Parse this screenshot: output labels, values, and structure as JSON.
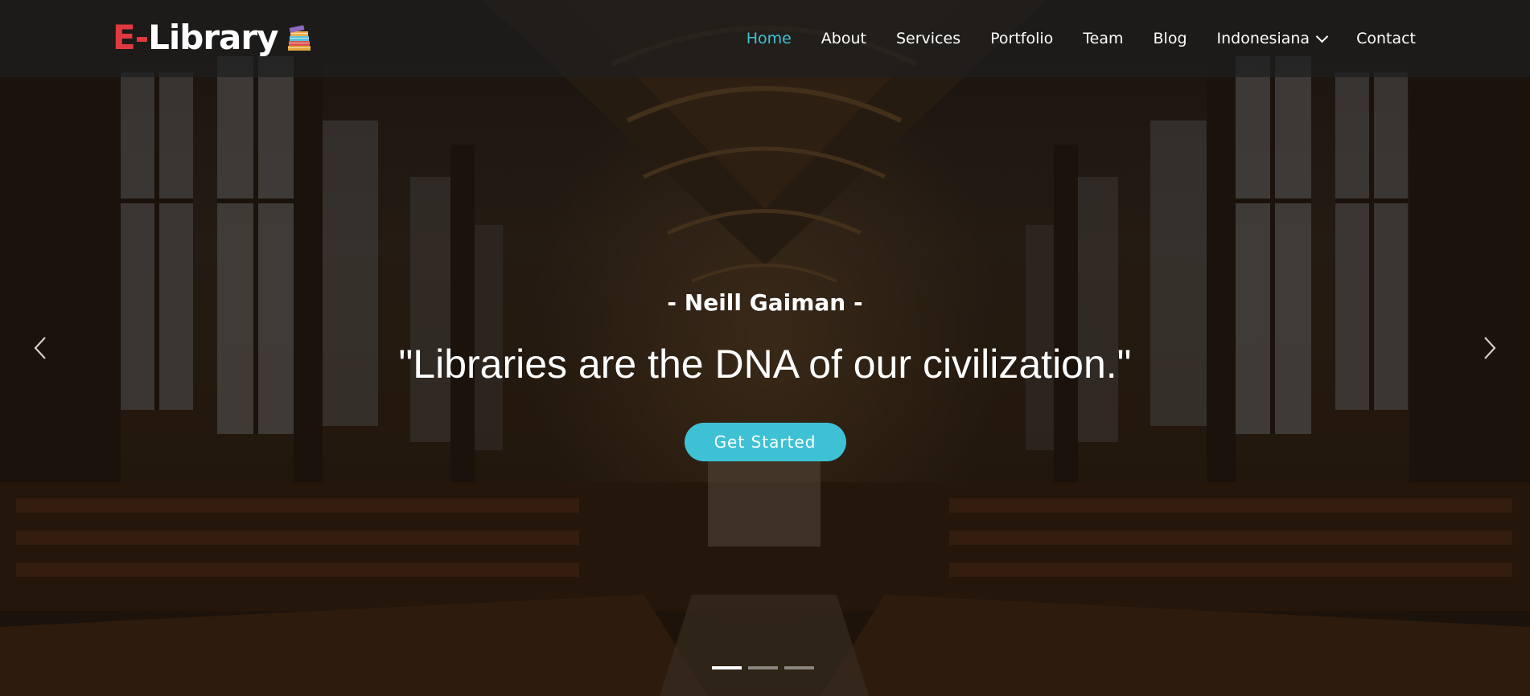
{
  "header": {
    "logo": {
      "prefix": "E-",
      "name": "Library",
      "icon": "books-icon"
    },
    "nav": [
      {
        "label": "Home",
        "active": true
      },
      {
        "label": "About",
        "active": false
      },
      {
        "label": "Services",
        "active": false
      },
      {
        "label": "Portfolio",
        "active": false
      },
      {
        "label": "Team",
        "active": false
      },
      {
        "label": "Blog",
        "active": false
      },
      {
        "label": "Indonesiana",
        "active": false,
        "dropdown": true
      },
      {
        "label": "Contact",
        "active": false
      }
    ]
  },
  "hero": {
    "author": "- Neill Gaiman -",
    "quote": "\"Libraries are the DNA of our civilization.\"",
    "cta_label": "Get Started",
    "prev_icon": "chevron-left-icon",
    "next_icon": "chevron-right-icon",
    "slide_count": 3,
    "active_slide": 1
  },
  "colors": {
    "accent": "#3ec1d5",
    "logo_accent": "#e03a3e",
    "header_bg": "rgba(30,30,30,0.72)"
  }
}
